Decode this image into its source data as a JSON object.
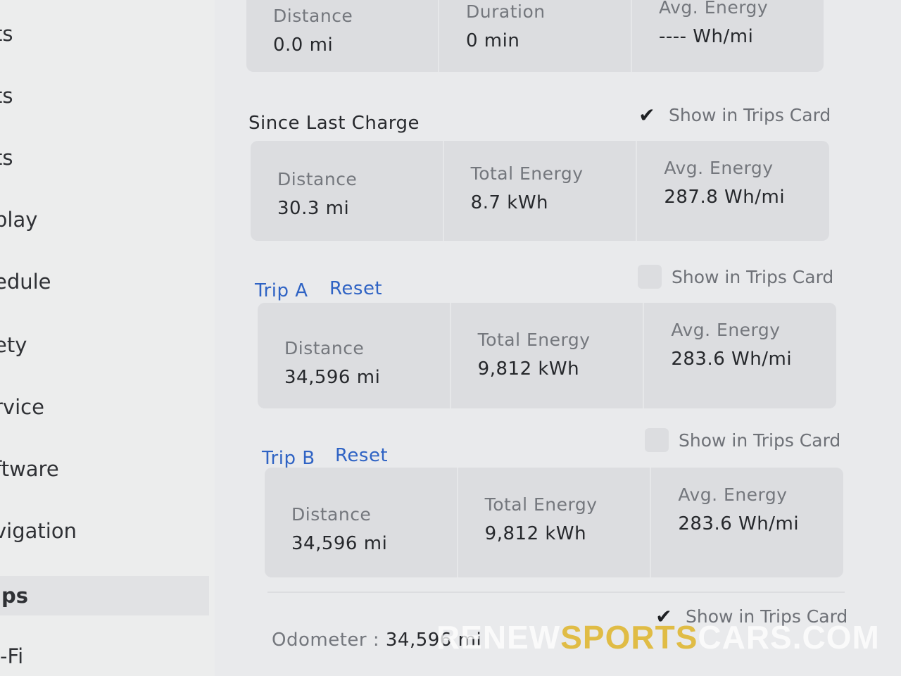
{
  "sidebar": {
    "items": [
      {
        "label": "ts"
      },
      {
        "label": "ts"
      },
      {
        "label": "ts"
      },
      {
        "label": "play"
      },
      {
        "label": "edule"
      },
      {
        "label": "ety"
      },
      {
        "label": "rvice"
      },
      {
        "label": "ftware"
      },
      {
        "label": "vigation"
      },
      {
        "label": "ips"
      },
      {
        "label": "i-Fi"
      }
    ]
  },
  "current_drive": {
    "distance_label": "Distance",
    "distance_value": "0.0  mi",
    "duration_label": "Duration",
    "duration_value": "0  min",
    "avg_label": "Avg. Energy",
    "avg_value": "----  Wh/mi"
  },
  "since_last_charge": {
    "title": "Since Last Charge",
    "show_label": "Show in Trips Card",
    "show_checked": true,
    "distance_label": "Distance",
    "distance_value": "30.3  mi",
    "energy_label": "Total Energy",
    "energy_value": "8.7  kWh",
    "avg_label": "Avg. Energy",
    "avg_value": "287.8  Wh/mi"
  },
  "trip_a": {
    "title": "Trip A",
    "reset_label": "Reset",
    "show_label": "Show in Trips Card",
    "show_checked": false,
    "distance_label": "Distance",
    "distance_value": "34,596  mi",
    "energy_label": "Total Energy",
    "energy_value": "9,812  kWh",
    "avg_label": "Avg. Energy",
    "avg_value": "283.6  Wh/mi"
  },
  "trip_b": {
    "title": "Trip B",
    "reset_label": "Reset",
    "show_label": "Show in Trips Card",
    "show_checked": false,
    "distance_label": "Distance",
    "distance_value": "34,596  mi",
    "energy_label": "Total Energy",
    "energy_value": "9,812  kWh",
    "avg_label": "Avg. Energy",
    "avg_value": "283.6  Wh/mi"
  },
  "odometer": {
    "label": "Odometer  :",
    "value": "34,596  mi",
    "show_label": "Show in Trips Card",
    "show_checked": true
  },
  "watermark": {
    "part1": "RENEW",
    "part2": "SPORTS",
    "part3": "CARS.COM"
  },
  "colors": {
    "link": "#2f63c4",
    "card": "#dcdde0",
    "background": "#e9eaec"
  }
}
